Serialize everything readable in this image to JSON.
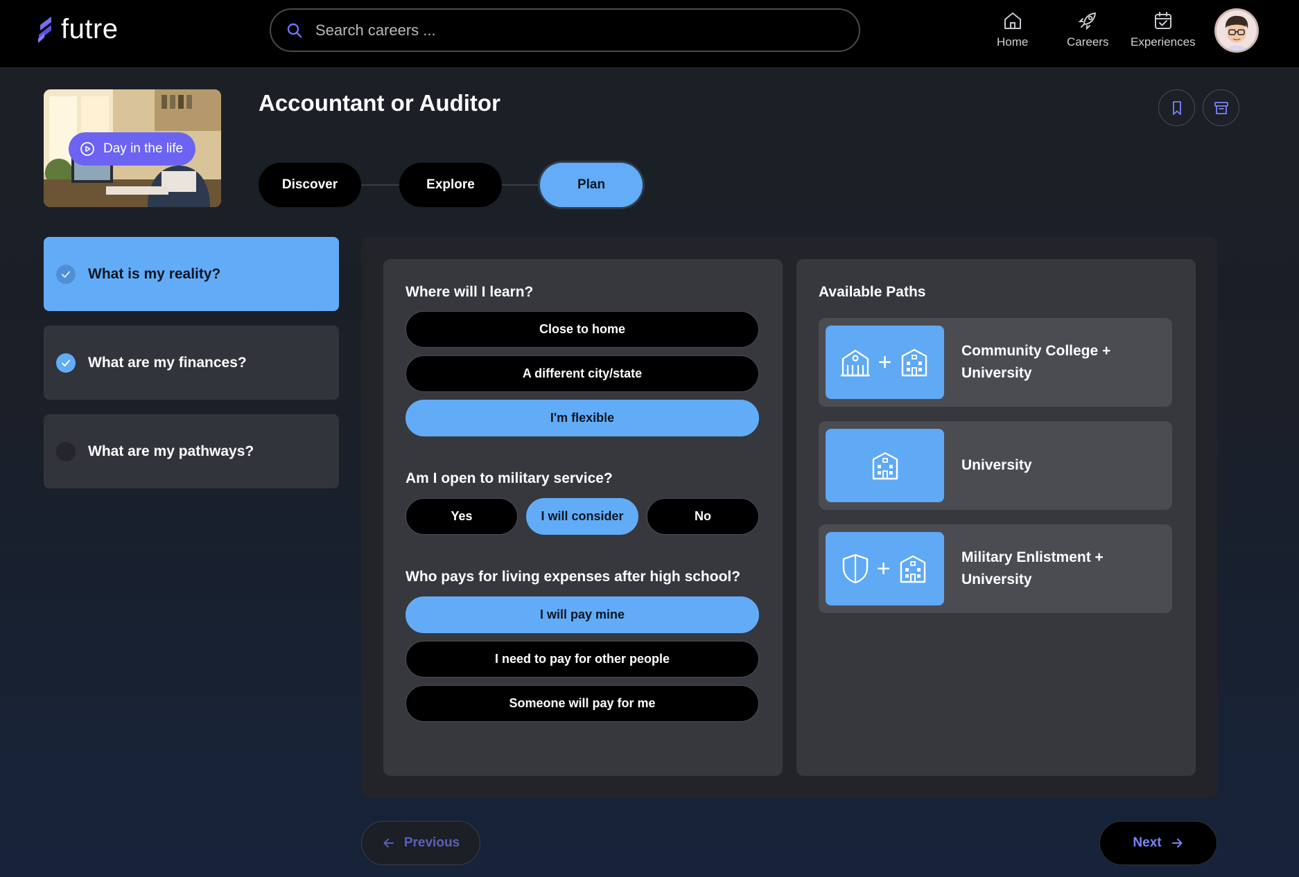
{
  "app": {
    "name": "futre"
  },
  "search": {
    "placeholder": "Search careers ..."
  },
  "nav": {
    "home": "Home",
    "careers": "Careers",
    "experiences": "Experiences"
  },
  "career": {
    "title": "Accountant or Auditor",
    "video_label": "Day in the life"
  },
  "stepper": {
    "discover": "Discover",
    "explore": "Explore",
    "plan": "Plan",
    "active": "Plan"
  },
  "sections": [
    {
      "label": "What is my reality?",
      "state": "complete-active"
    },
    {
      "label": "What are my finances?",
      "state": "complete"
    },
    {
      "label": "What are my pathways?",
      "state": "incomplete"
    }
  ],
  "questions": {
    "learn": {
      "title": "Where will I learn?",
      "options": [
        "Close to home",
        "A different city/state",
        "I'm flexible"
      ],
      "selected": "I'm flexible"
    },
    "military": {
      "title": "Am I open to military service?",
      "options": [
        "Yes",
        "I will consider",
        "No"
      ],
      "selected": "I will consider"
    },
    "living": {
      "title": "Who pays for living expenses after high school?",
      "options": [
        "I will pay mine",
        "I need to pay for other people",
        "Someone will pay for me"
      ],
      "selected": "I will pay mine"
    }
  },
  "paths": {
    "title": "Available Paths",
    "items": [
      {
        "line1": "Community College +",
        "line2": "University",
        "icons": [
          "college-icon",
          "plus",
          "university-icon"
        ]
      },
      {
        "line1": "University",
        "line2": "",
        "icons": [
          "university-icon"
        ]
      },
      {
        "line1": "Military Enlistment +",
        "line2": "University",
        "icons": [
          "shield-icon",
          "plus",
          "university-icon"
        ]
      }
    ]
  },
  "footer": {
    "previous": "Previous",
    "next": "Next"
  },
  "colors": {
    "accent_blue": "#62acf7",
    "brand_purple": "#6c63f2",
    "panel": "#222429",
    "card": "#36383d"
  }
}
